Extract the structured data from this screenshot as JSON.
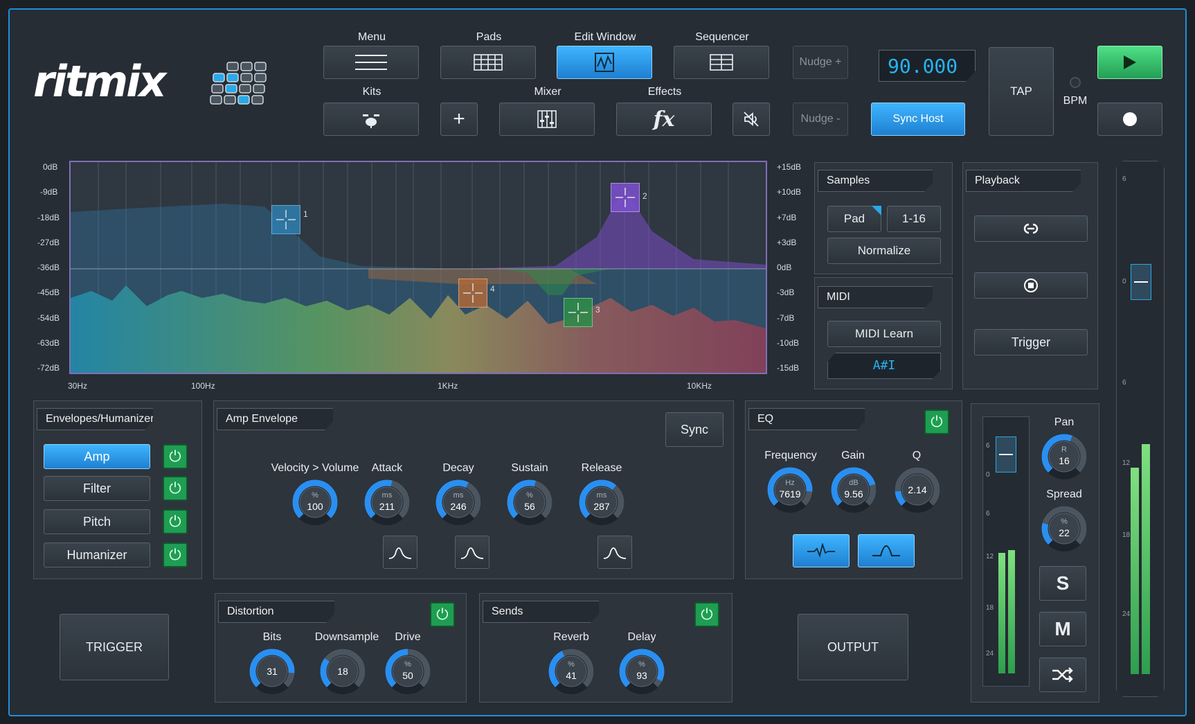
{
  "brand": {
    "name": "ritmix"
  },
  "toolbar": {
    "menu": "Menu",
    "pads": "Pads",
    "edit_window": "Edit Window",
    "sequencer": "Sequencer",
    "kits": "Kits",
    "mixer": "Mixer",
    "effects": "Effects",
    "nudge_plus": "Nudge +",
    "nudge_minus": "Nudge -",
    "tempo": "90.000",
    "sync_host": "Sync Host",
    "tap": "TAP",
    "bpm": "BPM"
  },
  "eq_display": {
    "left_axis": [
      "0dB",
      "-9dB",
      "-18dB",
      "-27dB",
      "-36dB",
      "-45dB",
      "-54dB",
      "-63dB",
      "-72dB"
    ],
    "right_axis": [
      "+15dB",
      "+10dB",
      "+7dB",
      "+3dB",
      "0dB",
      "-3dB",
      "-7dB",
      "-10dB",
      "-15dB"
    ],
    "freq_axis": [
      "30Hz",
      "100Hz",
      "1KHz",
      "10KHz"
    ],
    "handles": [
      "1",
      "2",
      "3",
      "4"
    ],
    "colors": {
      "band1": "#2f7fb0",
      "band2": "#7a4fc9",
      "band3": "#2f8a4a",
      "band4": "#b06a3a"
    }
  },
  "samples": {
    "title": "Samples",
    "pad": "Pad",
    "range": "1-16",
    "normalize": "Normalize"
  },
  "midi": {
    "title": "MIDI",
    "learn": "MIDI Learn",
    "display": "A#I"
  },
  "playback": {
    "title": "Playback",
    "trigger": "Trigger"
  },
  "envelopes": {
    "title": "Envelopes/Humanizer",
    "items": [
      "Amp",
      "Filter",
      "Pitch",
      "Humanizer"
    ]
  },
  "amp_envelope": {
    "title": "Amp Envelope",
    "sync": "Sync",
    "knobs": [
      {
        "label": "Velocity > Volume",
        "unit": "%",
        "value": "100",
        "level": 1.0
      },
      {
        "label": "Attack",
        "unit": "ms",
        "value": "211",
        "level": 0.55
      },
      {
        "label": "Decay",
        "unit": "ms",
        "value": "246",
        "level": 0.6
      },
      {
        "label": "Sustain",
        "unit": "%",
        "value": "56",
        "level": 0.56
      },
      {
        "label": "Release",
        "unit": "ms",
        "value": "287",
        "level": 0.65
      }
    ]
  },
  "eq": {
    "title": "EQ",
    "knobs": [
      {
        "label": "Frequency",
        "unit": "Hz",
        "value": "7619",
        "level": 0.85
      },
      {
        "label": "Gain",
        "unit": "dB",
        "value": "9.56",
        "level": 0.78
      },
      {
        "label": "Q",
        "unit": "",
        "value": "2.14",
        "level": 0.15
      }
    ]
  },
  "distortion": {
    "title": "Distortion",
    "knobs": [
      {
        "label": "Bits",
        "unit": "",
        "value": "31",
        "level": 0.85
      },
      {
        "label": "Downsample",
        "unit": "",
        "value": "18",
        "level": 0.3
      },
      {
        "label": "Drive",
        "unit": "%",
        "value": "50",
        "level": 0.5
      }
    ]
  },
  "sends": {
    "title": "Sends",
    "knobs": [
      {
        "label": "Reverb",
        "unit": "%",
        "value": "41",
        "level": 0.41
      },
      {
        "label": "Delay",
        "unit": "%",
        "value": "93",
        "level": 0.93
      }
    ]
  },
  "bottom": {
    "trigger": "TRIGGER",
    "output": "OUTPUT"
  },
  "channel": {
    "pan_label": "Pan",
    "pan_unit": "R",
    "pan_value": "16",
    "pan_level": 0.58,
    "spread_label": "Spread",
    "spread_unit": "%",
    "spread_value": "22",
    "spread_level": 0.22,
    "solo": "S",
    "mute": "M",
    "meter_scale": [
      "6",
      "0",
      "6",
      "12",
      "18",
      "24"
    ]
  },
  "master": {
    "meter_scale": [
      "6",
      "0",
      "6",
      "12",
      "18",
      "24"
    ]
  }
}
